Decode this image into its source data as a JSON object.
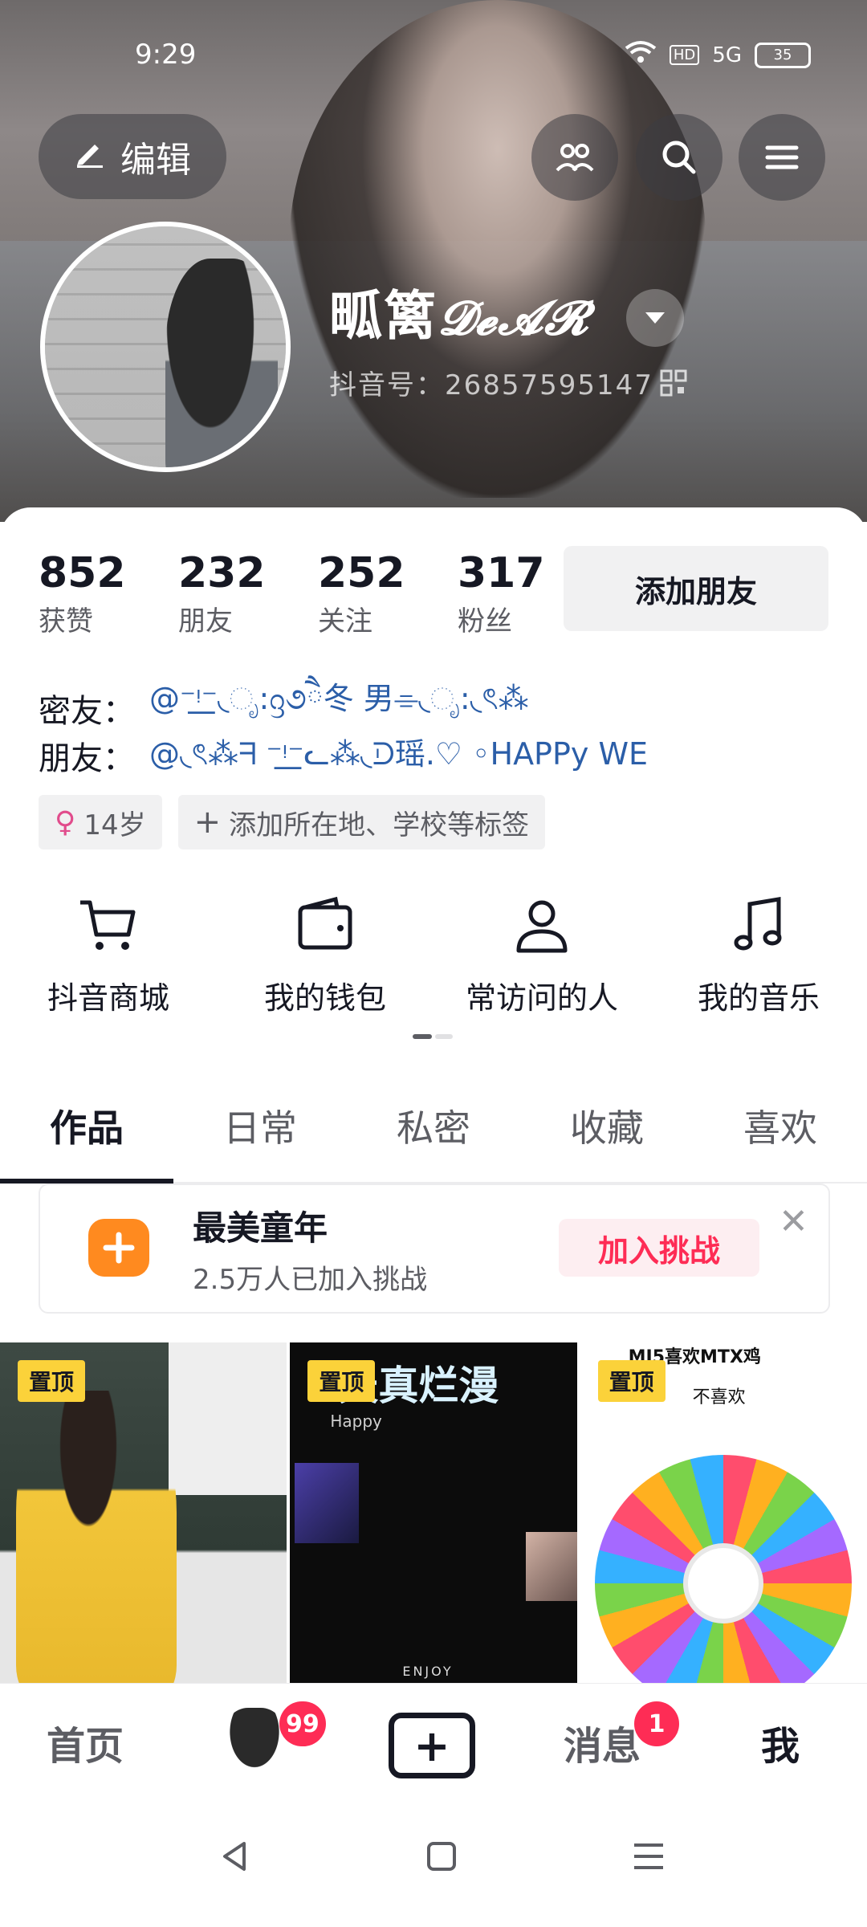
{
  "status_bar": {
    "time": "9:29",
    "network": "5G",
    "hd_label": "HD",
    "battery": "35"
  },
  "header": {
    "edit_label": "编辑",
    "nickname": "𝓓𝓮𝓐𝓡",
    "nickname_prefix": "畖篱",
    "douyin_id": "抖音号：26857595147"
  },
  "stats": [
    {
      "num": "852",
      "label": "获赞"
    },
    {
      "num": "232",
      "label": "朋友"
    },
    {
      "num": "252",
      "label": "关注"
    },
    {
      "num": "317",
      "label": "粉丝"
    }
  ],
  "add_friend_label": "添加朋友",
  "relations": [
    {
      "key": "密友：",
      "value": "@⁻ᵎ͟⁻◟ೃ:ᦋ૭ཻ冬   男⌯◟ೃ:◟ৎ⁂"
    },
    {
      "key": "朋友：",
      "value": "@◟ৎ⁂ᖷ ⁻ᵎ͟⁻ᓚ⁂◟ᑓ瑶.♡   ◦HAPPy WE"
    }
  ],
  "tags": {
    "age": "14岁",
    "add_tag": "添加所在地、学校等标签"
  },
  "shortcuts": [
    {
      "label": "抖音商城",
      "icon": "cart-icon"
    },
    {
      "label": "我的钱包",
      "icon": "wallet-icon"
    },
    {
      "label": "常访问的人",
      "icon": "person-icon"
    },
    {
      "label": "我的音乐",
      "icon": "music-icon"
    }
  ],
  "tabs": [
    "作品",
    "日常",
    "私密",
    "收藏",
    "喜欢"
  ],
  "active_tab": "作品",
  "challenge": {
    "title": "最美童年",
    "subtitle": "2.5万人已加入挑战",
    "join_label": "加入挑战"
  },
  "videos": [
    {
      "pin": "置顶"
    },
    {
      "pin": "置顶",
      "overlay_title": "天真烂漫",
      "overlay_sub": "Happy",
      "overlay_bottom": "ENJOY"
    },
    {
      "pin": "置顶",
      "overlay_top": "MJ5喜欢MTX鸡",
      "overlay_text": "不喜欢"
    }
  ],
  "bottom_nav": {
    "home": "首页",
    "friends_badge": "99",
    "messages": "消息",
    "messages_badge": "1",
    "me": "我"
  },
  "colors": {
    "accent": "#fe2c55",
    "pin": "#fbd23a",
    "challenge_icon": "#ff8a1f",
    "link": "#2b5ea8"
  }
}
